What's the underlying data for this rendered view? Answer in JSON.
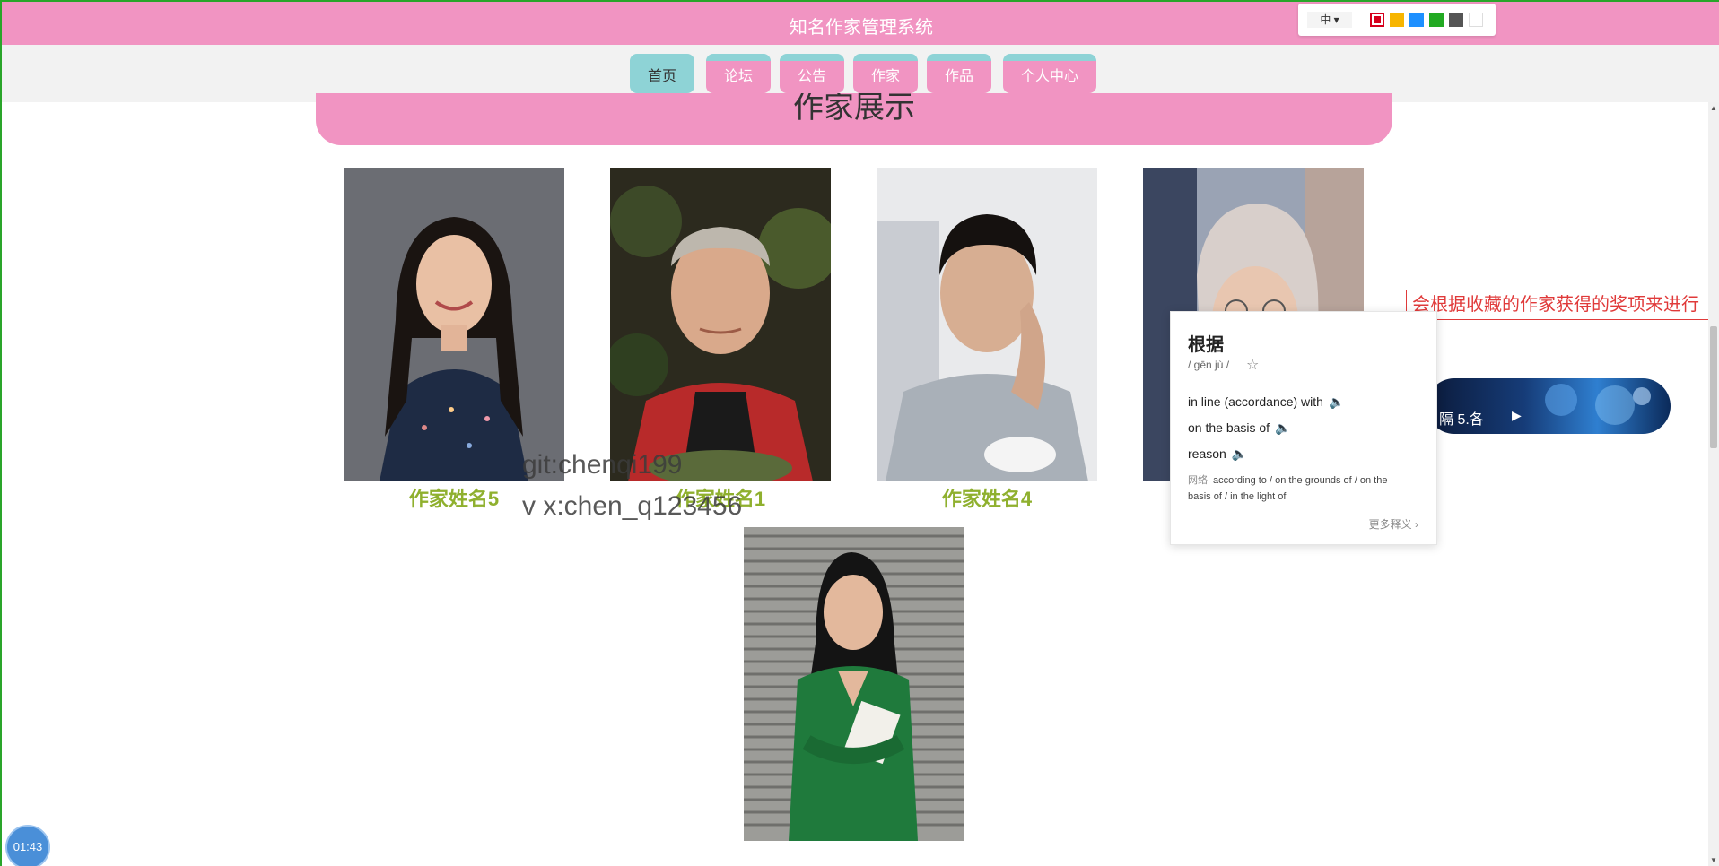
{
  "app": {
    "title": "知名作家管理系统",
    "toolbox": {
      "language": "中 ▾",
      "colors": [
        "#d6001c",
        "#f7b500",
        "#1e90ff",
        "#22aa22",
        "#555555",
        "#ffffff"
      ]
    }
  },
  "nav": {
    "items": [
      {
        "label": "首页",
        "active": true
      },
      {
        "label": "论坛"
      },
      {
        "label": "公告"
      },
      {
        "label": "作家"
      },
      {
        "label": "作品"
      },
      {
        "label": "个人中心"
      }
    ]
  },
  "section": {
    "title": "作家展示"
  },
  "writers": [
    {
      "name": "作家姓名5",
      "photo": "portrait-woman-dark-floral-dress"
    },
    {
      "name": "作家姓名1",
      "photo": "portrait-elderly-man-red-jacket"
    },
    {
      "name": "作家姓名4",
      "photo": "portrait-man-gray-shirt-hand-on-cheek"
    },
    {
      "name": "",
      "photo": "portrait-woman-glasses-partial"
    },
    {
      "name": "",
      "photo": "portrait-woman-green-dress-holding-book"
    }
  ],
  "watermark": {
    "line1": "git:chenqi199",
    "line2": "v x:chen_q123456"
  },
  "highlight_text": "会根据收藏的作家获得的奖项来进行",
  "player": {
    "text": "隔   5.各",
    "play_icon": "play-icon"
  },
  "dictionary": {
    "word": "根据",
    "pinyin": "/ gēn jù /",
    "definitions": [
      "in line  (accordance)  with",
      "on the basis of",
      "reason"
    ],
    "web_label": "网络",
    "web_text": "according to / on the grounds of / on the basis of / in the light of",
    "more": "更多释义 ›"
  },
  "timer": {
    "value": "01:43"
  }
}
